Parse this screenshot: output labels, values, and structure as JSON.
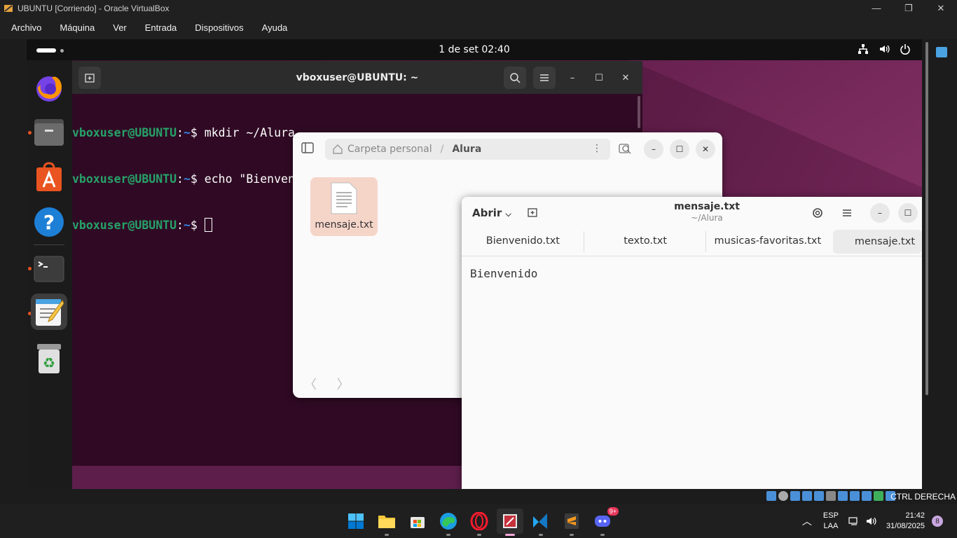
{
  "host": {
    "window_title": "UBUNTU [Corriendo] - Oracle VirtualBox",
    "menu": [
      "Archivo",
      "Máquina",
      "Ver",
      "Entrada",
      "Dispositivos",
      "Ayuda"
    ],
    "controls": {
      "minimize": "—",
      "restore": "❐",
      "close": "✕"
    },
    "host_key_label": "CTRL DERECHA"
  },
  "ubuntu": {
    "clock": "1 de set  02:40",
    "tray_icons": [
      "network-icon",
      "volume-icon",
      "power-icon"
    ],
    "dock": [
      "firefox",
      "files",
      "app-center",
      "help",
      "terminal",
      "text-editor",
      "trash"
    ]
  },
  "terminal": {
    "title": "vboxuser@UBUNTU: ~",
    "lines": [
      {
        "user": "vboxuser@UBUNTU",
        "sep": ":",
        "path": "~",
        "prompt": "$ ",
        "cmd": "mkdir ~/Alura"
      },
      {
        "user": "vboxuser@UBUNTU",
        "sep": ":",
        "path": "~",
        "prompt": "$ ",
        "cmd": "echo \"Bienvenido\" > ~/Alura/mensaje.txt"
      },
      {
        "user": "vboxuser@UBUNTU",
        "sep": ":",
        "path": "~",
        "prompt": "$ ",
        "cmd": ""
      }
    ]
  },
  "files": {
    "path_home": "Carpeta personal",
    "path_sep": "/",
    "path_current": "Alura",
    "items": [
      {
        "name": "mensaje.txt"
      }
    ]
  },
  "editor": {
    "open_label": "Abrir",
    "title": "mensaje.txt",
    "subtitle": "~/Alura",
    "tabs": [
      {
        "label": "Bienvenido.txt",
        "active": false
      },
      {
        "label": "texto.txt",
        "active": false
      },
      {
        "label": "musicas-favoritas.txt",
        "active": false
      },
      {
        "label": "mensaje.txt",
        "active": true
      }
    ],
    "content": "Bienvenido"
  },
  "taskbar": {
    "apps": [
      "windows-start",
      "file-explorer",
      "microsoft-store",
      "edge",
      "opera",
      "virtualbox",
      "vscode",
      "sublime",
      "discord"
    ],
    "discord_badge": "9+",
    "lang_line1": "ESP",
    "lang_line2": "LAA",
    "time": "21:42",
    "date": "31/08/2025",
    "notifications": "8"
  }
}
